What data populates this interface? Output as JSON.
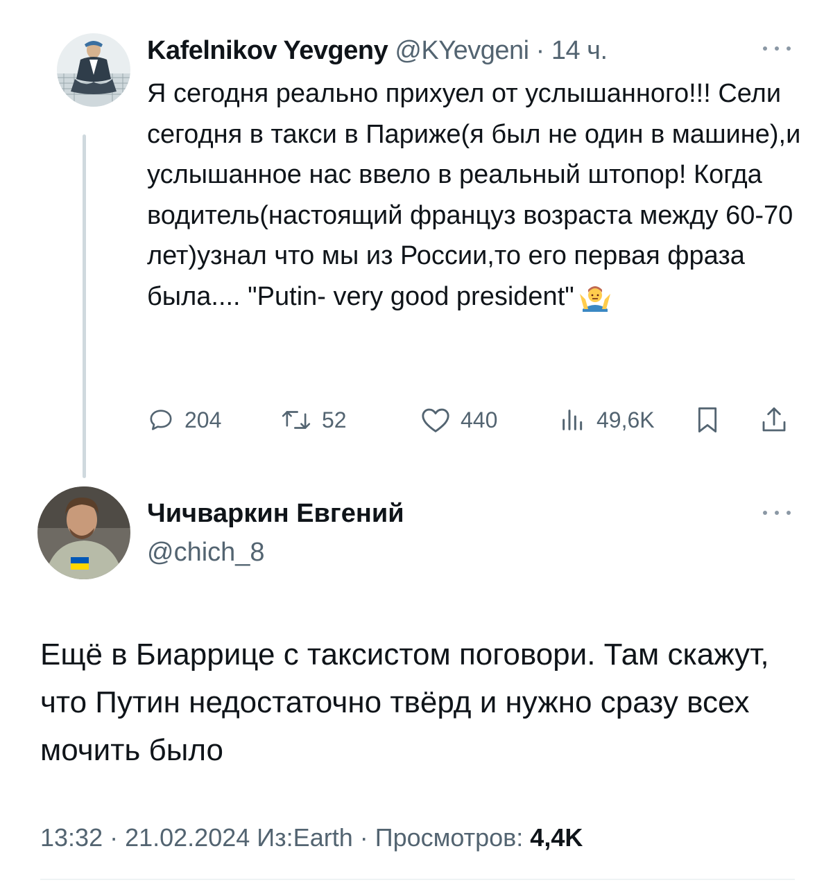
{
  "tweet_parent": {
    "author_name": "Kafelnikov Yevgeny",
    "handle": "@KYevgeni",
    "separator": " · ",
    "time": "14 ч.",
    "text": "Я сегодня реально прихуел от услышанного!!! Сели сегодня в такси в Париже(я был не один в машине),и услышанное нас ввело в реальный штопор! Когда водитель(настоящий француз возраста между 60-70 лет)узнал что мы из России,то его первая фраза была.... \"Putin- very good president\"",
    "emoji": "man-shrugging-emoji",
    "actions": {
      "replies": "204",
      "retweets": "52",
      "likes": "440",
      "views": "49,6K"
    }
  },
  "tweet_reply": {
    "author_name": "Чичваркин Евгений",
    "handle": "@chich_8",
    "text": "Ещё в Биаррице с таксистом поговори. Там скажут, что Путин недостаточно твёрд и нужно сразу всех мочить было",
    "meta": {
      "time": "13:32",
      "separator": " · ",
      "date": "21.02.2024",
      "source": "Из:Earth",
      "views_label": "Просмотров: ",
      "views": "4,4K"
    }
  },
  "icons": {
    "reply": "reply-icon",
    "retweet": "retweet-icon",
    "like": "heart-icon",
    "views": "views-icon",
    "bookmark": "bookmark-icon",
    "share": "share-icon",
    "more": "more-icon"
  },
  "colors": {
    "text_primary": "#0f1419",
    "text_secondary": "#536471",
    "thread_line": "#cfd9de",
    "flag_blue": "#0057b7",
    "flag_yellow": "#ffd700"
  }
}
